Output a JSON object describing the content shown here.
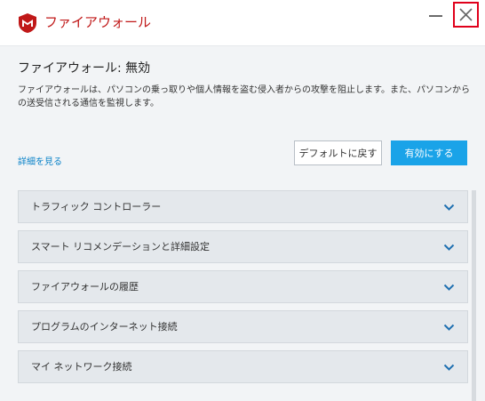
{
  "window": {
    "title": "ファイアウォール"
  },
  "status": {
    "heading": "ファイアウォール: 無効",
    "description": "ファイアウォールは、パソコンの乗っ取りや個人情報を盗む侵入者からの攻撃を阻止します。また、パソコンからの送受信される通信を監視します。"
  },
  "actions": {
    "details_link": "詳細を見る",
    "default_button": "デフォルトに戻す",
    "enable_button": "有効にする"
  },
  "sections": [
    {
      "label": "トラフィック コントローラー"
    },
    {
      "label": "スマート リコメンデーションと詳細設定"
    },
    {
      "label": "ファイアウォールの履歴"
    },
    {
      "label": "プログラムのインターネット接続"
    },
    {
      "label": "マイ ネットワーク接続"
    }
  ],
  "colors": {
    "brand_red": "#c01818",
    "accent_blue": "#1aa3e8",
    "link_blue": "#0a82c8",
    "chevron_blue": "#1e6fb0"
  }
}
